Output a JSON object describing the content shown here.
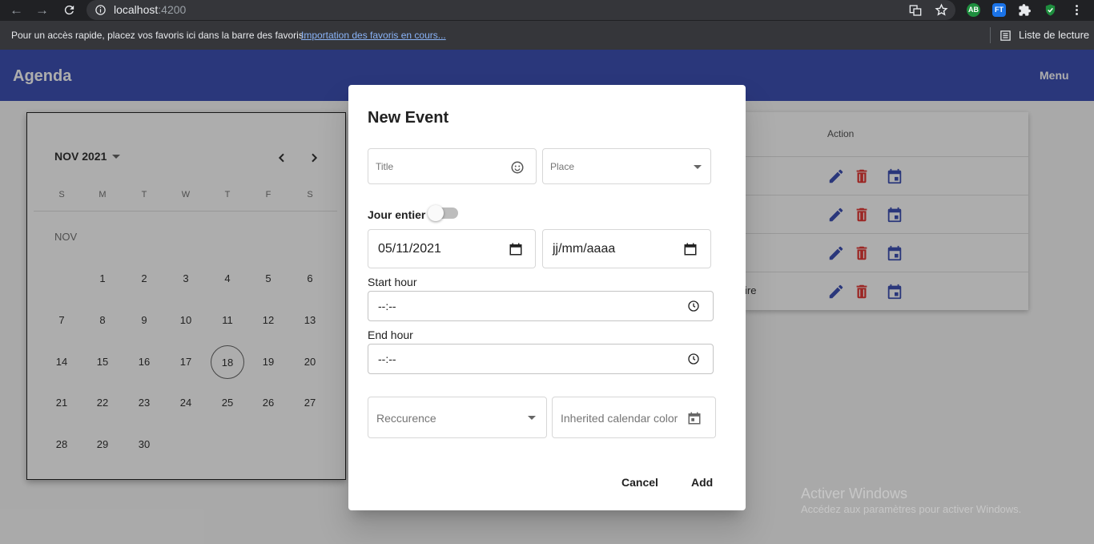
{
  "browser": {
    "url_host": "localhost",
    "url_port": ":4200",
    "bookmark_hint": "Pour un accès rapide, placez vos favoris ici dans la barre des favoris.",
    "bookmark_link": "Importation des favoris en cours...",
    "reading_list": "Liste de lecture",
    "ext_ab": "AB",
    "ext_ft": "FT"
  },
  "app": {
    "title": "Agenda",
    "menu_label": "Menu"
  },
  "calendar": {
    "month_label": "NOV 2021",
    "section_label": "NOV",
    "weekdays": [
      "S",
      "M",
      "T",
      "W",
      "T",
      "F",
      "S"
    ],
    "weeks": [
      [
        "",
        "1",
        "2",
        "3",
        "4",
        "5",
        "6"
      ],
      [
        "7",
        "8",
        "9",
        "10",
        "11",
        "12",
        "13"
      ],
      [
        "14",
        "15",
        "16",
        "17",
        "18",
        "19",
        "20"
      ],
      [
        "21",
        "22",
        "23",
        "24",
        "25",
        "26",
        "27"
      ],
      [
        "28",
        "29",
        "30",
        "",
        "",
        "",
        ""
      ]
    ],
    "today": "18"
  },
  "table": {
    "action_header": "Action",
    "partial_cell": "ire"
  },
  "dialog": {
    "title": "New Event",
    "title_placeholder": "Title",
    "place_placeholder": "Place",
    "all_day_label": "Jour entier",
    "start_date_value": "05/11/2021",
    "end_date_value": "jj/mm/aaaa",
    "start_hour_label": "Start hour",
    "start_hour_value": "--:--",
    "end_hour_label": "End hour",
    "end_hour_value": "--:--",
    "recurrence_placeholder": "Reccurence",
    "color_placeholder": "Inherited calendar color",
    "cancel_label": "Cancel",
    "add_label": "Add"
  },
  "watermark": {
    "line1": "Activer Windows",
    "line2": "Accédez aux paramètres pour activer Windows."
  },
  "colors": {
    "primary": "#3f51b5",
    "edit_icon": "#3f51b5",
    "delete_icon": "#e53935",
    "link": "#8ab4f8"
  }
}
